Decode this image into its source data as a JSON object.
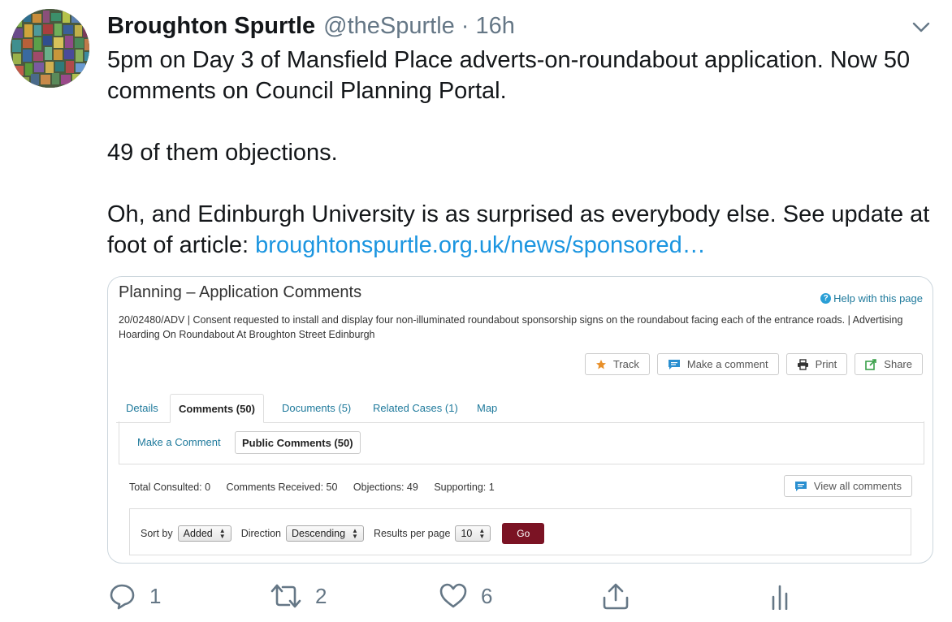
{
  "tweet": {
    "author_name": "Broughton Spurtle",
    "author_handle": "@theSpurtle",
    "separator": "·",
    "time": "16h",
    "text_line1": "5pm on Day 3 of Mansfield Place adverts-on-roundabout application. Now 50 comments on Council Planning Portal.",
    "text_line2": "49 of them objections.",
    "text_line3_pre": "Oh, and Edinburgh University is as surprised as everybody else. See update at foot of article: ",
    "link_text": "broughtonspurtle.org.uk/news/sponsored…"
  },
  "portal": {
    "title": "Planning – Application Comments",
    "help": "Help with this page",
    "description": "20/02480/ADV | Consent requested to install and display four non-illuminated roundabout sponsorship signs on the roundabout facing each of the entrance roads. | Advertising Hoarding On Roundabout At Broughton Street Edinburgh",
    "actions": [
      "Track",
      "Make a comment",
      "Print",
      "Share"
    ],
    "tabs": [
      "Details",
      "Comments (50)",
      "Documents (5)",
      "Related Cases (1)",
      "Map"
    ],
    "subtabs": [
      "Make a Comment",
      "Public Comments (50)"
    ],
    "stats": {
      "total_consulted": "Total Consulted: 0",
      "comments_received": "Comments Received: 50",
      "objections": "Objections: 49",
      "supporting": "Supporting: 1"
    },
    "view_all": "View all comments",
    "sort": {
      "sort_by_label": "Sort by",
      "sort_by_value": "Added",
      "direction_label": "Direction",
      "direction_value": "Descending",
      "results_label": "Results per page",
      "results_value": "10",
      "go": "Go"
    }
  },
  "footer": {
    "replies": "1",
    "retweets": "2",
    "likes": "6"
  },
  "colors": {
    "link": "#1b95e0",
    "secondary_text": "#657786",
    "go_button": "#7b1324",
    "portal_link": "#1f7a9c"
  }
}
